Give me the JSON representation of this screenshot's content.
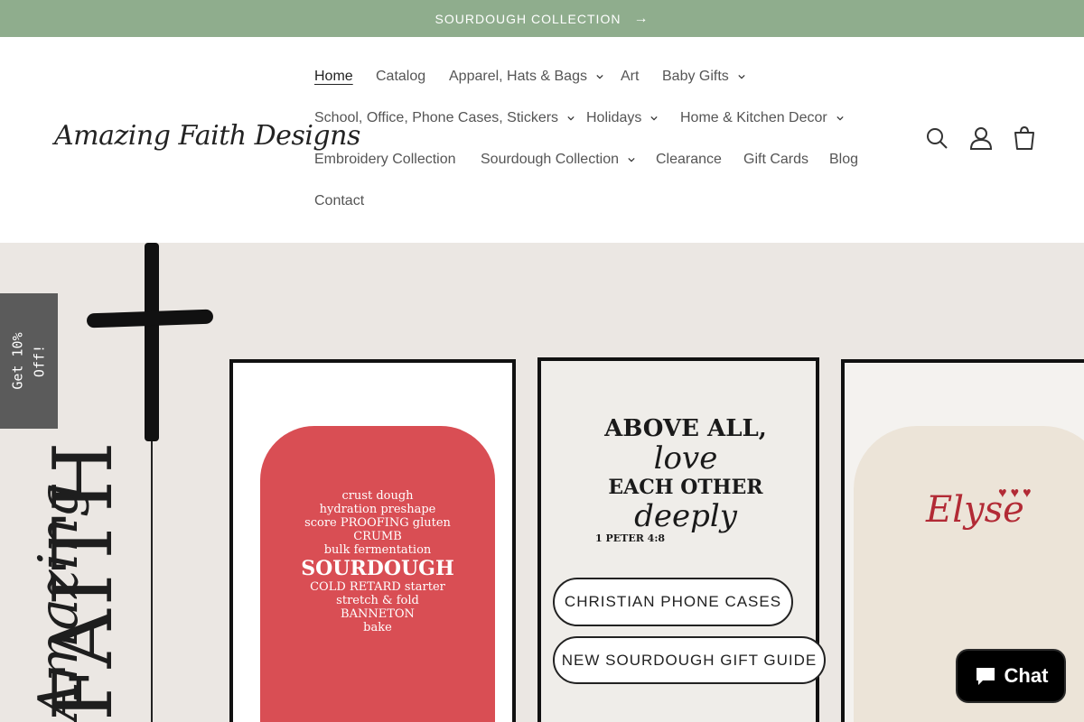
{
  "announcement": {
    "text": "SOURDOUGH COLLECTION",
    "arrow": "→"
  },
  "header": {
    "logo": "Amazing Faith Designs",
    "nav": [
      {
        "label": "Home",
        "active": true,
        "dropdown": false
      },
      {
        "label": "Catalog",
        "dropdown": false
      },
      {
        "label": "Apparel, Hats & Bags",
        "dropdown": true
      },
      {
        "label": "Art",
        "dropdown": false
      },
      {
        "label": "Baby Gifts",
        "dropdown": true
      },
      {
        "label": "School, Office, Phone Cases, Stickers",
        "dropdown": true
      },
      {
        "label": "Holidays",
        "dropdown": true
      },
      {
        "label": "Home & Kitchen Decor",
        "dropdown": true
      },
      {
        "label": "Embroidery Collection",
        "dropdown": false
      },
      {
        "label": "Sourdough Collection",
        "dropdown": true
      },
      {
        "label": "Clearance",
        "dropdown": false
      },
      {
        "label": "Gift Cards",
        "dropdown": false
      },
      {
        "label": "Blog",
        "dropdown": false
      },
      {
        "label": "Contact",
        "dropdown": false
      }
    ],
    "icons": [
      "search-icon",
      "account-icon",
      "cart-icon"
    ]
  },
  "hero": {
    "vertical_title": "FAITH",
    "vertical_script": "Amazing",
    "cards": {
      "sweatshirt": {
        "words_top": "crust   dough",
        "words_2": "hydration   preshape",
        "words_3": "score PROOFING   gluten CRUMB",
        "words_4": "bulk fermentation",
        "big": "SOURDOUGH",
        "words_5": "COLD RETARD starter",
        "words_6": "stretch & fold",
        "words_7": "BANNETON",
        "words_8": "bake"
      },
      "sign": {
        "l1": "ABOVE ALL,",
        "l2": "love",
        "l3": "EACH OTHER",
        "l4": "deeply",
        "l5": "1 PETER 4:8"
      },
      "sweater": {
        "name": "Elyse",
        "hearts": "♥♥♥"
      }
    },
    "buttons": {
      "phone_cases": "CHRISTIAN PHONE CASES",
      "gift_guide": "NEW SOURDOUGH GIFT GUIDE"
    }
  },
  "side_tab": {
    "line1": "Get 10%",
    "line2": "Off!"
  },
  "chat": {
    "label": "Chat"
  }
}
